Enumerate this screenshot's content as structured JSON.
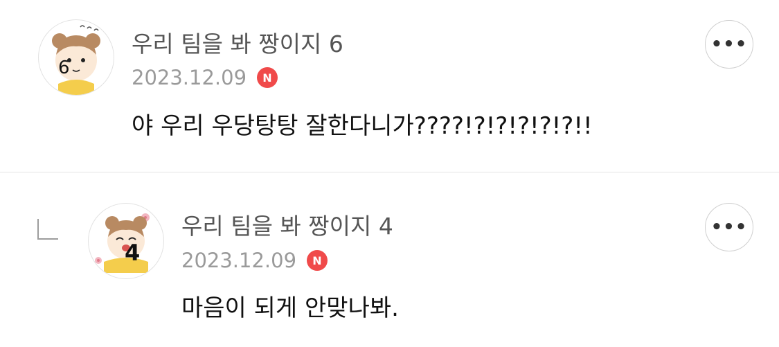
{
  "comments": [
    {
      "author": "우리 팀을 봐 짱이지 6",
      "date": "2023.12.09",
      "badge": "N",
      "text": "야 우리 우당탕탕 잘한다니가????!?!?!?!?!?!!",
      "avatar_number": "6",
      "more_label": "•••"
    },
    {
      "author": "우리 팀을 봐 짱이지 4",
      "date": "2023.12.09",
      "badge": "N",
      "text": "마음이 되게 안맞나봐.",
      "avatar_number": "4",
      "more_label": "•••"
    }
  ],
  "colors": {
    "badge": "#f04a4a",
    "author": "#555555",
    "date": "#9a9a9a",
    "text": "#111111"
  },
  "icons": {
    "reply": "reply-arrow-icon",
    "more": "more-dots-icon",
    "new": "new-badge-icon"
  }
}
